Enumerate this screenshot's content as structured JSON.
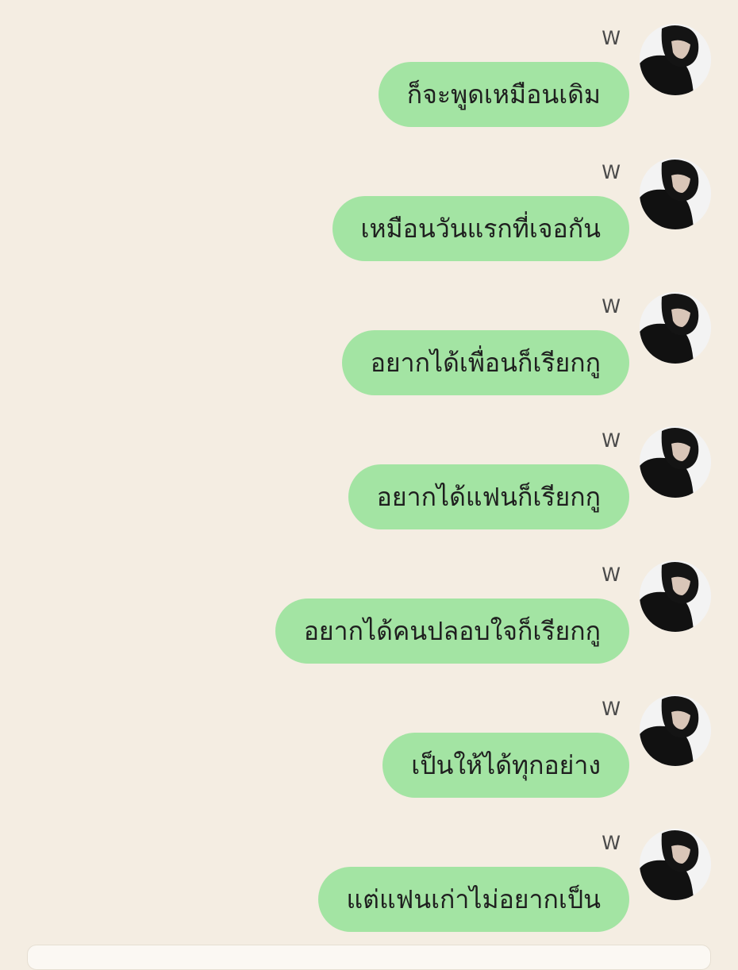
{
  "chat": {
    "messages": [
      {
        "sender": "W",
        "text": "ก็จะพูดเหมือนเดิม"
      },
      {
        "sender": "W",
        "text": "เหมือนวันแรกที่เจอกัน"
      },
      {
        "sender": "W",
        "text": "อยากได้เพื่อนก็เรียกกู"
      },
      {
        "sender": "W",
        "text": "อยากได้แฟนก็เรียกกู"
      },
      {
        "sender": "W",
        "text": "อยากได้คนปลอบใจก็เรียกกู"
      },
      {
        "sender": "W",
        "text": "เป็นให้ได้ทุกอย่าง"
      },
      {
        "sender": "W",
        "text": "แต่แฟนเก่าไม่อยากเป็น"
      }
    ]
  },
  "colors": {
    "background": "#f4ede2",
    "bubble": "#a3e4a3",
    "text": "#1f1f1f",
    "sender": "#4a4a4a"
  }
}
